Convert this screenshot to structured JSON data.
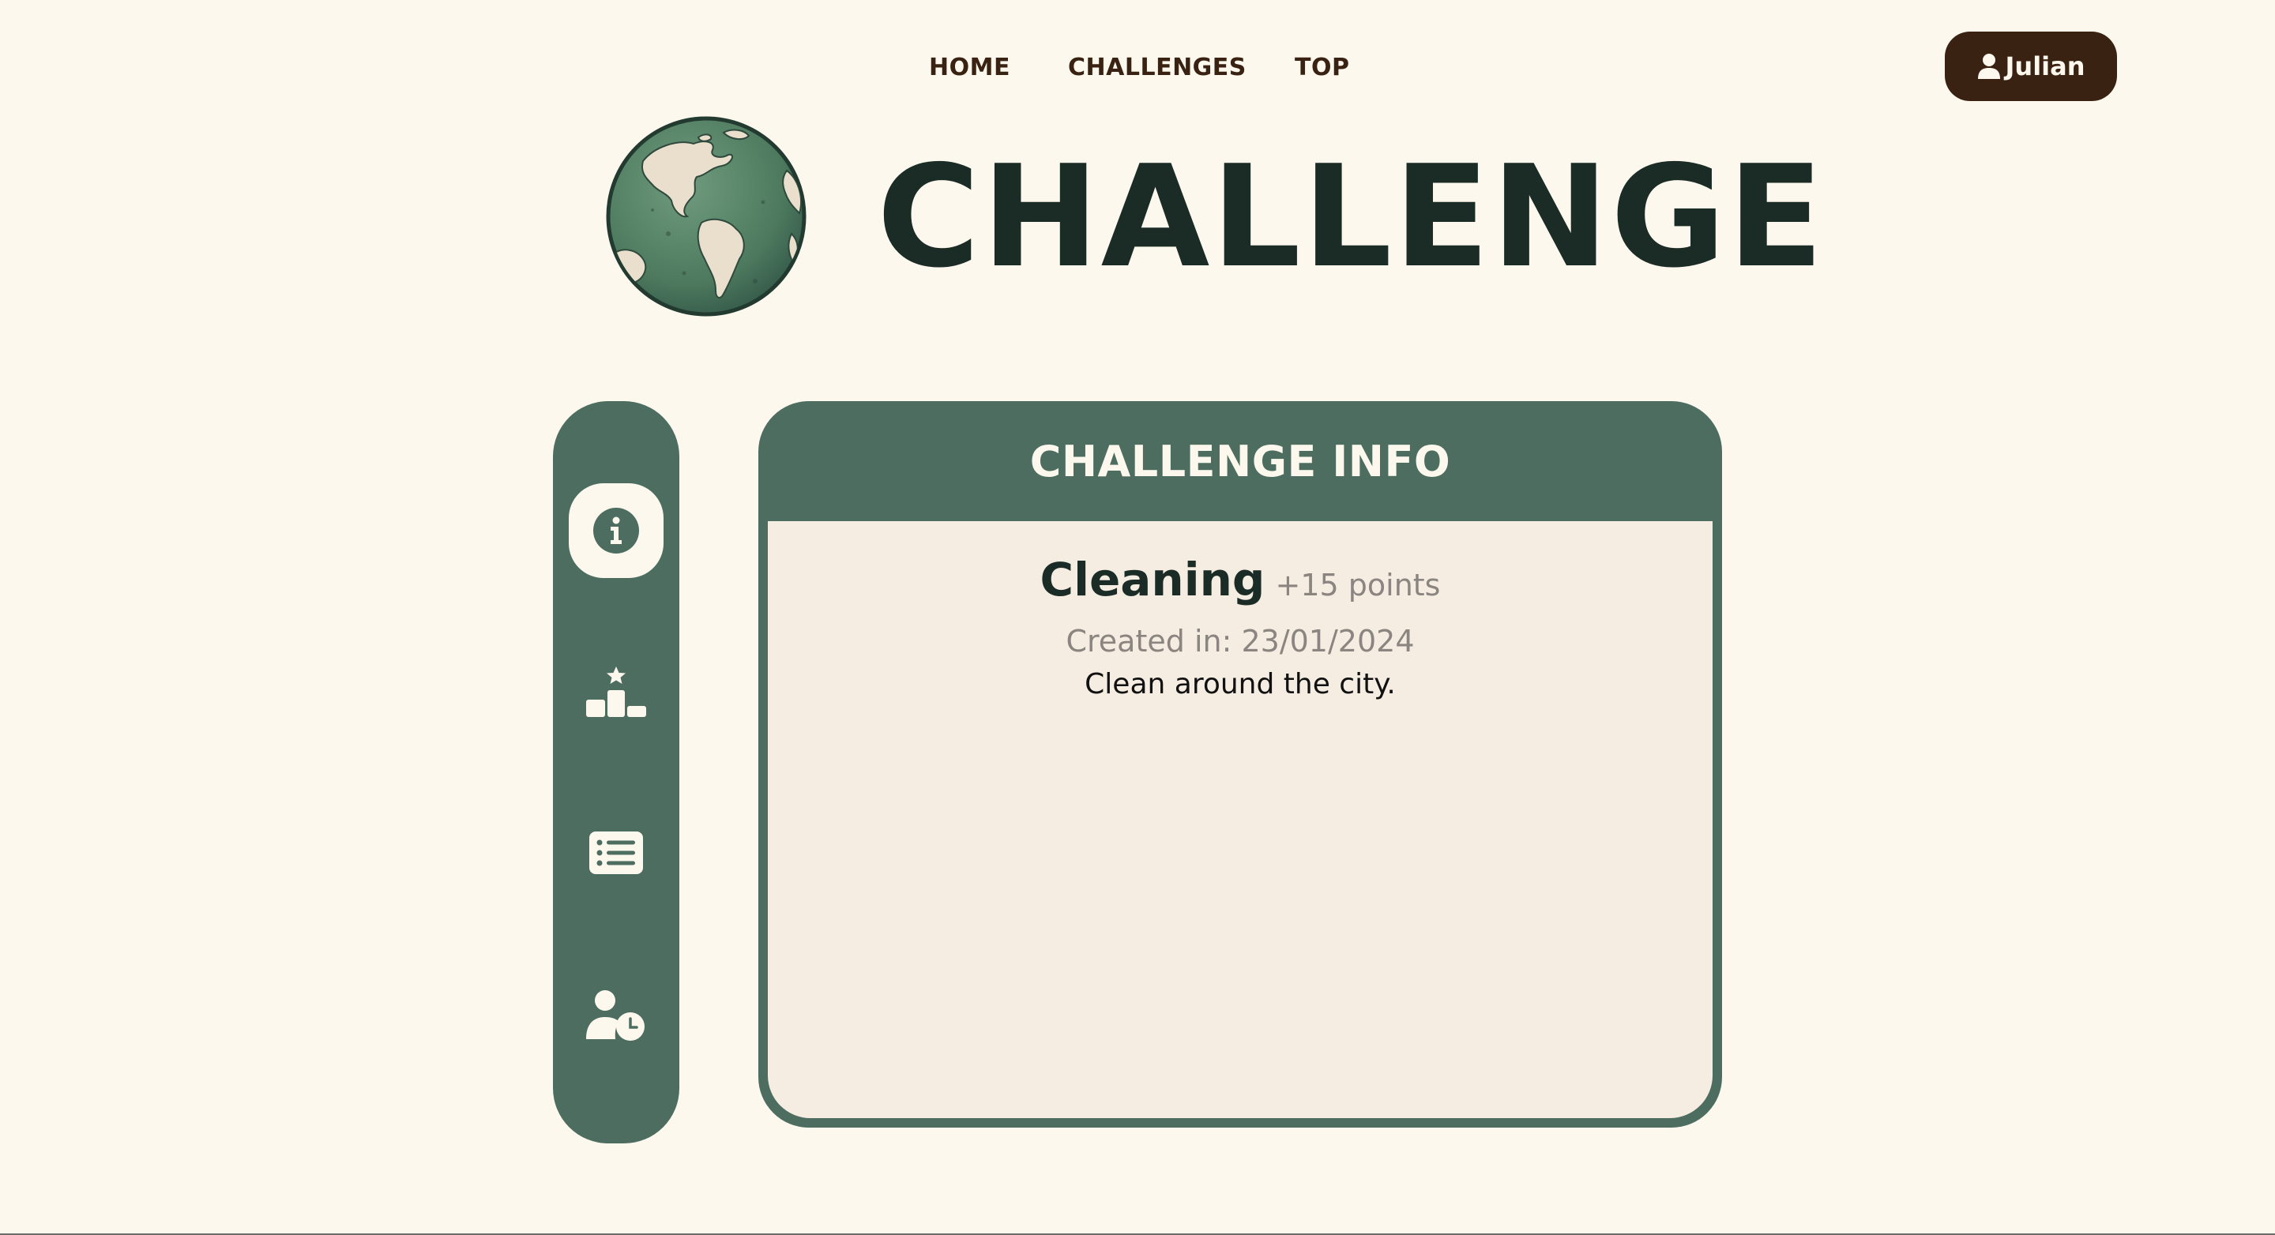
{
  "nav": {
    "links": [
      "HOME",
      "CHALLENGES",
      "TOP"
    ]
  },
  "user": {
    "name": "Julian",
    "icon": "user-icon"
  },
  "hero": {
    "title": "CHALLENGE",
    "logo": "globe-logo"
  },
  "sidebar": {
    "items": [
      {
        "icon": "info-icon",
        "active": true
      },
      {
        "icon": "podium-icon",
        "active": false
      },
      {
        "icon": "list-icon",
        "active": false
      },
      {
        "icon": "user-clock-icon",
        "active": false
      }
    ]
  },
  "card": {
    "title": "CHALLENGE INFO",
    "name": "Cleaning",
    "points": "+15 points",
    "created": "Created in: 23/01/2024",
    "description": "Clean around the city."
  },
  "colors": {
    "background": "#fdf8ee",
    "primary_green": "#4d6d60",
    "dark_brown": "#3a2212",
    "dark_text": "#1b2b26",
    "card_body": "#f5ece2",
    "muted_text": "#8a8580"
  }
}
